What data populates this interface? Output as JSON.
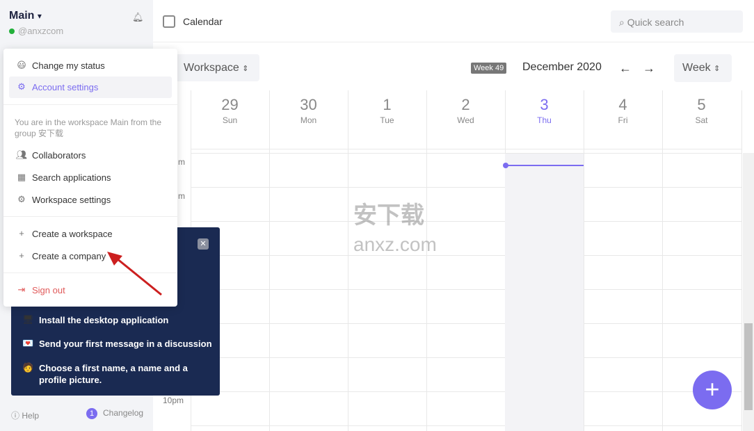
{
  "sidebar": {
    "workspace": "Main",
    "chevron": "▾",
    "handle": "@anxzcom",
    "help": "Help",
    "changelog": "Changelog",
    "changelog_count": "1"
  },
  "header": {
    "title": "Calendar",
    "search_placeholder": "Quick search"
  },
  "toolbar": {
    "scope": "Workspace",
    "week_badge": "Week 49",
    "month": "December 2020",
    "view": "Week",
    "prev": "←",
    "next": "→"
  },
  "days": [
    {
      "num": "29",
      "name": "Sun"
    },
    {
      "num": "30",
      "name": "Mon"
    },
    {
      "num": "1",
      "name": "Tue"
    },
    {
      "num": "2",
      "name": "Wed"
    },
    {
      "num": "3",
      "name": "Thu",
      "today": true
    },
    {
      "num": "4",
      "name": "Fri"
    },
    {
      "num": "5",
      "name": "Sat"
    }
  ],
  "time_labels": {
    "first": "m",
    "second": "m",
    "last": "10pm"
  },
  "menu": {
    "change_status": "Change my status",
    "account_settings": "Account settings",
    "info": "You are in the workspace Main from the group 安下载",
    "collaborators": "Collaborators",
    "search_apps": "Search applications",
    "workspace_settings": "Workspace settings",
    "create_workspace": "Create a workspace",
    "create_company": "Create a company",
    "sign_out": "Sign out"
  },
  "onboarding": {
    "items": [
      "Install the desktop application",
      "Send your first message in a discussion",
      "Choose a first name, a name and a profile picture."
    ]
  },
  "watermark": "安下载 anxz.com",
  "colors": {
    "accent": "#7b6cf0",
    "danger": "#e05a5a",
    "onboarding_bg": "#1a2a52"
  }
}
